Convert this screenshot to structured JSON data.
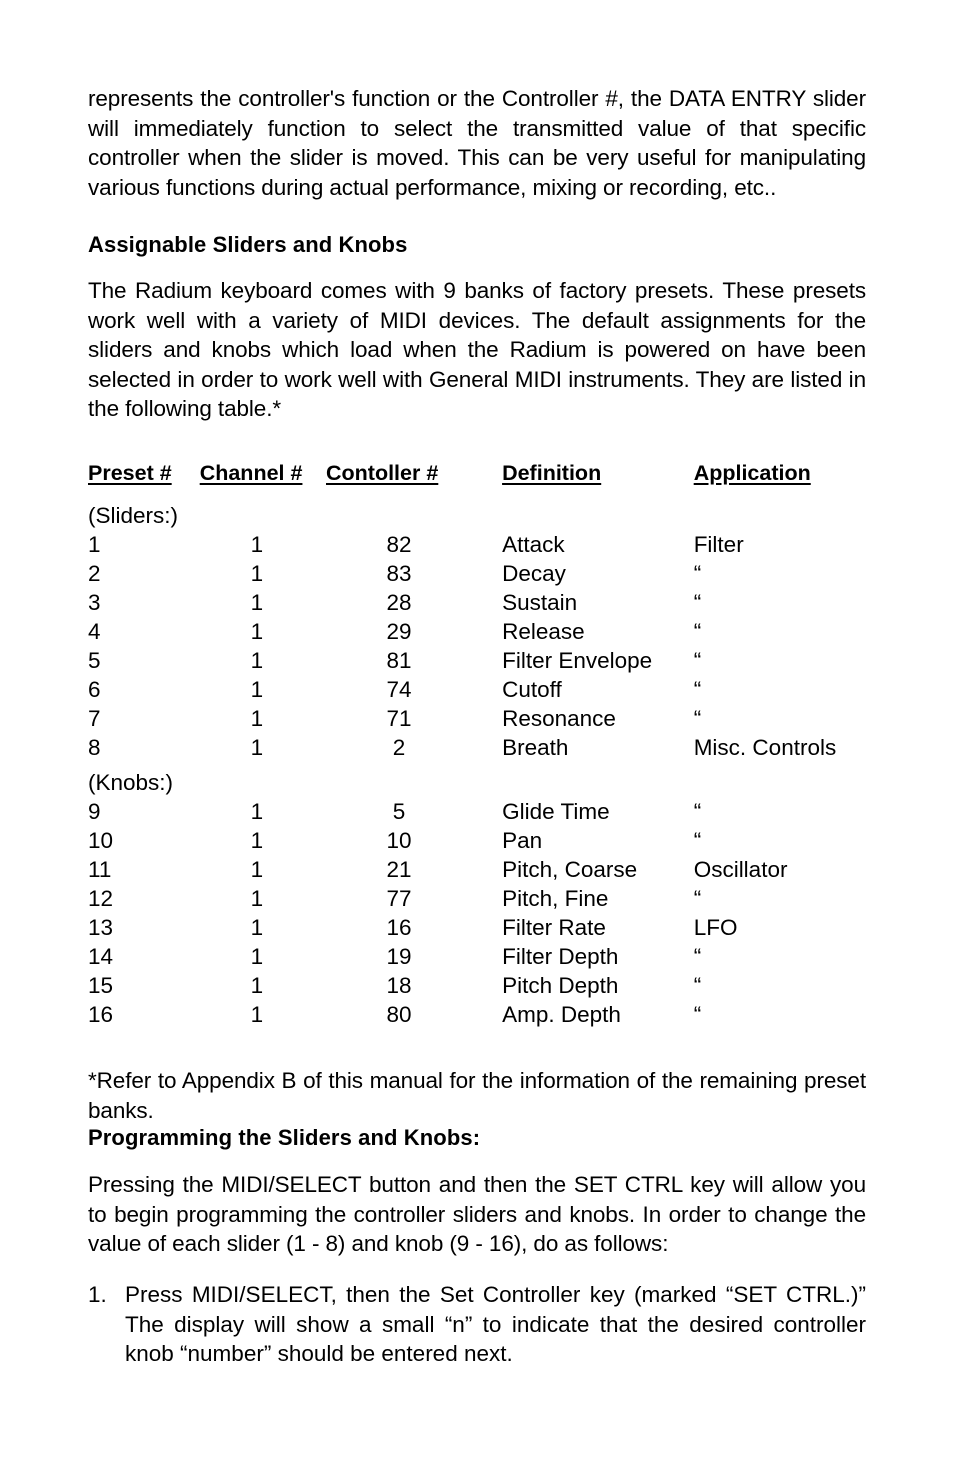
{
  "document": {
    "paragraph_1": "represents the controller's function or the Controller #, the DATA ENTRY slider will immediately function to select the transmitted value of  that specific controller when the slider is moved. This can be very useful for manipulating various functions during actual performance, mixing or recording, etc..",
    "heading_1": "Assignable Sliders and Knobs",
    "paragraph_2": "The Radium keyboard comes with 9 banks of factory presets. These presets work well with a variety of MIDI devices. The default assignments for the sliders and knobs which load when the Radium is powered on have been selected in order to work well with General MIDI instruments. They are listed in the following table.*",
    "footnote": "*Refer to Appendix B of this manual for the information of the remaining preset banks.",
    "heading_2": "Programming the Sliders and Knobs:",
    "paragraph_3": "Pressing the MIDI/SELECT button and then the SET CTRL key will allow you to begin programming the controller sliders and knobs. In order to change the value of each slider (1 - 8) and knob (9 - 16), do as follows:",
    "steps": [
      {
        "marker": "1.",
        "text": "Press MIDI/SELECT, then the Set Controller key (marked “SET CTRL.)” The display will show a small “n” to indicate that the desired controller knob “number” should be entered next."
      }
    ]
  },
  "table": {
    "headers": {
      "preset": "Preset #",
      "channel": "Channel #",
      "controller": "Contoller #",
      "definition": "Definition",
      "application": "Application"
    },
    "group_sliders_label": "(Sliders:)",
    "group_knobs_label": "(Knobs:)",
    "ditto": "“",
    "sliders": [
      {
        "preset": "1",
        "channel": "1",
        "controller": "82",
        "definition": "Attack",
        "application": "Filter"
      },
      {
        "preset": "2",
        "channel": "1",
        "controller": "83",
        "definition": "Decay",
        "application": "“"
      },
      {
        "preset": "3",
        "channel": "1",
        "controller": "28",
        "definition": "Sustain",
        "application": "“"
      },
      {
        "preset": "4",
        "channel": "1",
        "controller": "29",
        "definition": "Release",
        "application": "“"
      },
      {
        "preset": "5",
        "channel": "1",
        "controller": "81",
        "definition": "Filter Envelope",
        "application": "“"
      },
      {
        "preset": "6",
        "channel": "1",
        "controller": "74",
        "definition": "Cutoff",
        "application": "“"
      },
      {
        "preset": "7",
        "channel": "1",
        "controller": "71",
        "definition": "Resonance",
        "application": "“"
      },
      {
        "preset": "8",
        "channel": "1",
        "controller": "2",
        "definition": "Breath",
        "application": "Misc. Controls"
      }
    ],
    "knobs": [
      {
        "preset": "9",
        "channel": "1",
        "controller": "5",
        "definition": "Glide Time",
        "application": "“"
      },
      {
        "preset": "10",
        "channel": "1",
        "controller": "10",
        "definition": "Pan",
        "application": "“"
      },
      {
        "preset": "11",
        "channel": "1",
        "controller": "21",
        "definition": "Pitch, Coarse",
        "application": "Oscillator"
      },
      {
        "preset": "12",
        "channel": "1",
        "controller": "77",
        "definition": "Pitch, Fine",
        "application": "“"
      },
      {
        "preset": "13",
        "channel": "1",
        "controller": "16",
        "definition": "Filter Rate",
        "application": "LFO"
      },
      {
        "preset": "14",
        "channel": "1",
        "controller": "19",
        "definition": "Filter Depth",
        "application": "“"
      },
      {
        "preset": "15",
        "channel": "1",
        "controller": "18",
        "definition": "Pitch Depth",
        "application": "“"
      },
      {
        "preset": "16",
        "channel": "1",
        "controller": "80",
        "definition": "Amp. Depth",
        "application": "“"
      }
    ]
  }
}
